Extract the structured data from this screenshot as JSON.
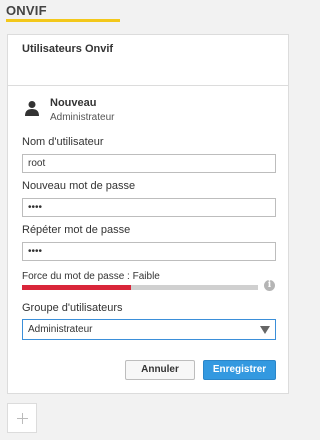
{
  "tab": {
    "title": "ONVIF",
    "accent_color": "#f3c81b"
  },
  "card": {
    "title": "Utilisateurs Onvif"
  },
  "user": {
    "name": "Nouveau",
    "role": "Administrateur",
    "icon": "user-icon"
  },
  "form": {
    "username_label": "Nom d'utilisateur",
    "username_value": "root",
    "new_password_label": "Nouveau mot de passe",
    "new_password_value": "••••",
    "repeat_password_label": "Répéter mot de passe",
    "repeat_password_value": "••••",
    "strength_label": "Force du mot de passe : Faible",
    "strength_level": 0.46,
    "strength_color": "#d9263a",
    "info_icon": "info-icon",
    "group_label": "Groupe d'utilisateurs",
    "group_value": "Administrateur"
  },
  "actions": {
    "cancel_label": "Annuler",
    "save_label": "Enregistrer"
  },
  "add_button": {
    "icon": "plus-icon"
  }
}
